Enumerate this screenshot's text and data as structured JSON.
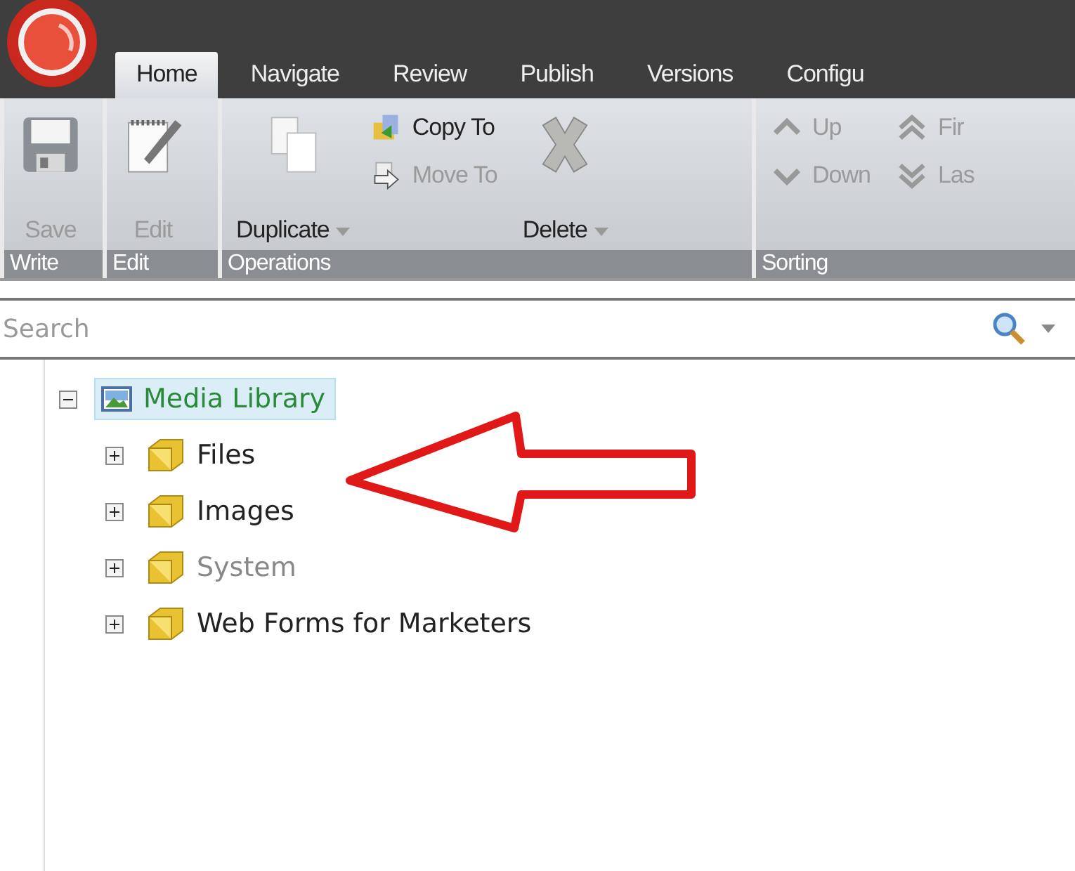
{
  "tabs": [
    {
      "label": "Home",
      "selected": true
    },
    {
      "label": "Navigate",
      "selected": false
    },
    {
      "label": "Review",
      "selected": false
    },
    {
      "label": "Publish",
      "selected": false
    },
    {
      "label": "Versions",
      "selected": false
    },
    {
      "label": "Configu",
      "selected": false
    }
  ],
  "ribbon": [
    {
      "title": "Write",
      "buttons": [
        {
          "label": "Save",
          "kind": "large",
          "disabled": true,
          "dropdown": false
        }
      ]
    },
    {
      "title": "Edit",
      "buttons": [
        {
          "label": "Edit",
          "kind": "large",
          "disabled": true,
          "dropdown": false
        }
      ]
    },
    {
      "title": "Operations",
      "buttons": [
        {
          "label": "Duplicate",
          "kind": "large",
          "disabled": false,
          "dropdown": true
        },
        {
          "label": "Copy To",
          "kind": "small",
          "disabled": false
        },
        {
          "label": "Move To",
          "kind": "small",
          "disabled": true
        },
        {
          "label": "Delete",
          "kind": "large",
          "disabled": false,
          "dropdown": true
        }
      ]
    },
    {
      "title": "Sorting",
      "buttons": [
        {
          "label": "Up",
          "kind": "small",
          "disabled": true
        },
        {
          "label": "Down",
          "kind": "small",
          "disabled": true
        },
        {
          "label": "Fir",
          "kind": "small",
          "disabled": true
        },
        {
          "label": "Las",
          "kind": "small",
          "disabled": true
        }
      ]
    }
  ],
  "search": {
    "placeholder": "Search"
  },
  "tree": [
    {
      "label": "Media Library",
      "expanded": true,
      "selected": true,
      "dimmed": false,
      "children": [
        {
          "label": "Files",
          "expanded": false,
          "selected": false,
          "dimmed": false
        },
        {
          "label": "Images",
          "expanded": false,
          "selected": false,
          "dimmed": false
        },
        {
          "label": "System",
          "expanded": false,
          "selected": false,
          "dimmed": true
        },
        {
          "label": "Web Forms for Marketers",
          "expanded": false,
          "selected": false,
          "dimmed": false
        }
      ]
    }
  ]
}
